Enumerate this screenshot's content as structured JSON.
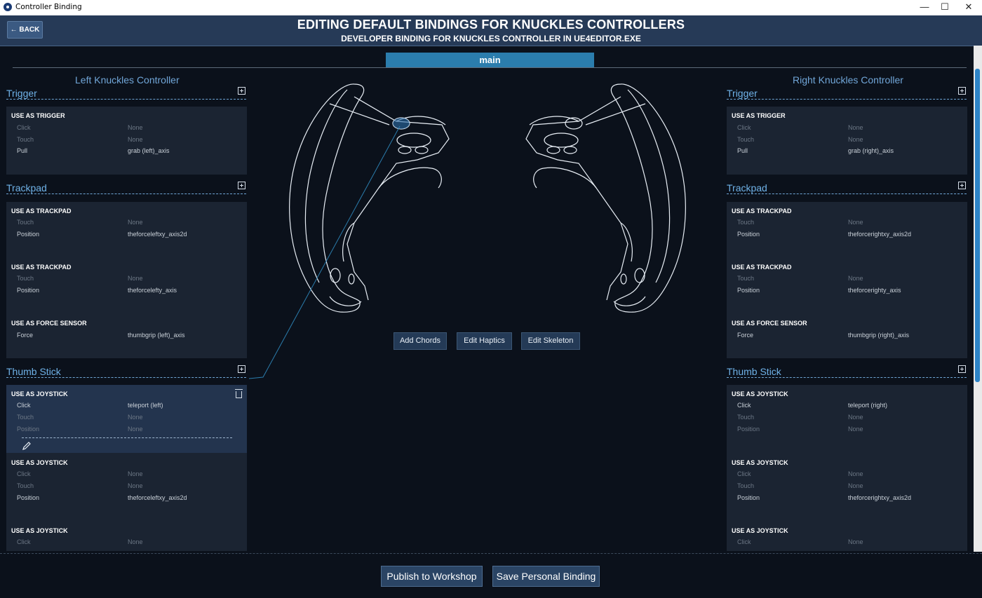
{
  "window": {
    "title": "Controller Binding",
    "min": "—",
    "max": "☐",
    "close": "✕"
  },
  "header": {
    "back_label": "← BACK",
    "title": "EDITING DEFAULT BINDINGS FOR KNUCKLES CONTROLLERS",
    "subtitle": "DEVELOPER BINDING FOR KNUCKLES CONTROLLER IN UE4EDITOR.EXE"
  },
  "tabs": [
    {
      "label": "main",
      "active": true
    }
  ],
  "left": {
    "title": "Left Knuckles Controller",
    "trigger": {
      "title": "Trigger",
      "groups": [
        {
          "title": "USE AS TRIGGER",
          "rows": [
            {
              "label": "Click",
              "value": "None"
            },
            {
              "label": "Touch",
              "value": "None"
            },
            {
              "label": "Pull",
              "value": "grab (left)_axis"
            }
          ]
        }
      ]
    },
    "trackpad": {
      "title": "Trackpad",
      "groups": [
        {
          "title": "USE AS TRACKPAD",
          "rows": [
            {
              "label": "Touch",
              "value": "None"
            },
            {
              "label": "Position",
              "value": "theforceleftxy_axis2d"
            }
          ]
        },
        {
          "title": "USE AS TRACKPAD",
          "rows": [
            {
              "label": "Touch",
              "value": "None"
            },
            {
              "label": "Position",
              "value": "theforcelefty_axis"
            }
          ]
        },
        {
          "title": "USE AS FORCE SENSOR",
          "rows": [
            {
              "label": "Force",
              "value": "thumbgrip (left)_axis"
            }
          ]
        }
      ]
    },
    "thumbstick": {
      "title": "Thumb Stick",
      "groups": [
        {
          "title": "USE AS JOYSTICK",
          "rows": [
            {
              "label": "Click",
              "value": "teleport (left)"
            },
            {
              "label": "Touch",
              "value": "None"
            },
            {
              "label": "Position",
              "value": "None"
            }
          ]
        },
        {
          "title": "USE AS JOYSTICK",
          "rows": [
            {
              "label": "Click",
              "value": "None"
            },
            {
              "label": "Touch",
              "value": "None"
            },
            {
              "label": "Position",
              "value": "theforceleftxy_axis2d"
            }
          ]
        },
        {
          "title": "USE AS JOYSTICK",
          "rows": [
            {
              "label": "Click",
              "value": "None"
            }
          ]
        }
      ]
    }
  },
  "right": {
    "title": "Right Knuckles Controller",
    "trigger": {
      "title": "Trigger",
      "groups": [
        {
          "title": "USE AS TRIGGER",
          "rows": [
            {
              "label": "Click",
              "value": "None"
            },
            {
              "label": "Touch",
              "value": "None"
            },
            {
              "label": "Pull",
              "value": "grab (right)_axis"
            }
          ]
        }
      ]
    },
    "trackpad": {
      "title": "Trackpad",
      "groups": [
        {
          "title": "USE AS TRACKPAD",
          "rows": [
            {
              "label": "Touch",
              "value": "None"
            },
            {
              "label": "Position",
              "value": "theforcerightxy_axis2d"
            }
          ]
        },
        {
          "title": "USE AS TRACKPAD",
          "rows": [
            {
              "label": "Touch",
              "value": "None"
            },
            {
              "label": "Position",
              "value": "theforcerighty_axis"
            }
          ]
        },
        {
          "title": "USE AS FORCE SENSOR",
          "rows": [
            {
              "label": "Force",
              "value": "thumbgrip (right)_axis"
            }
          ]
        }
      ]
    },
    "thumbstick": {
      "title": "Thumb Stick",
      "groups": [
        {
          "title": "USE AS JOYSTICK",
          "rows": [
            {
              "label": "Click",
              "value": "teleport (right)"
            },
            {
              "label": "Touch",
              "value": "None"
            },
            {
              "label": "Position",
              "value": "None"
            }
          ]
        },
        {
          "title": "USE AS JOYSTICK",
          "rows": [
            {
              "label": "Click",
              "value": "None"
            },
            {
              "label": "Touch",
              "value": "None"
            },
            {
              "label": "Position",
              "value": "theforcerightxy_axis2d"
            }
          ]
        },
        {
          "title": "USE AS JOYSTICK",
          "rows": [
            {
              "label": "Click",
              "value": "None"
            }
          ]
        }
      ]
    }
  },
  "center_buttons": {
    "add_chords": "Add Chords",
    "edit_haptics": "Edit Haptics",
    "edit_skeleton": "Edit Skeleton"
  },
  "footer": {
    "publish": "Publish to Workshop",
    "save": "Save Personal Binding"
  },
  "colors": {
    "accent": "#2b7dad",
    "section_title": "#6fb2e8",
    "panel": "#1b2432",
    "active_panel": "#23344e"
  }
}
